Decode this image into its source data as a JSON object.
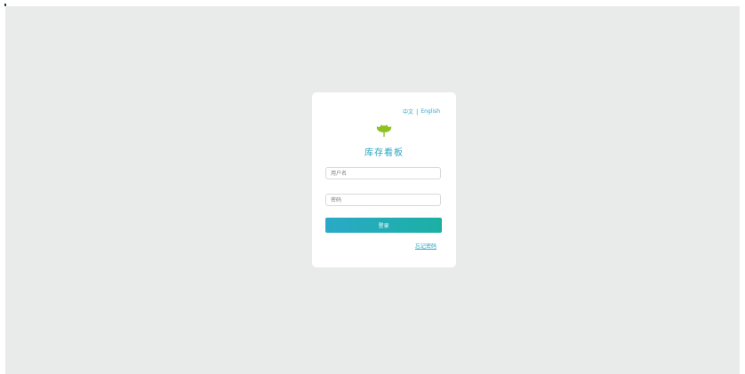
{
  "card": {
    "lang_chinese": "中文",
    "lang_separator": "|",
    "lang_english": "English",
    "logo_icon": "ginkgo-leaf-icon",
    "title": "库存看板",
    "username_placeholder": "用户名",
    "password_placeholder": "密码",
    "login_label": "登录",
    "forgot_password_label": "忘记密码"
  },
  "colors": {
    "accent": "#2aa6c0",
    "logo_green": "#8dc21f",
    "background": "#e9eaea",
    "button_gradient_start": "#2aa9c8",
    "button_gradient_end": "#1bb0a4"
  }
}
